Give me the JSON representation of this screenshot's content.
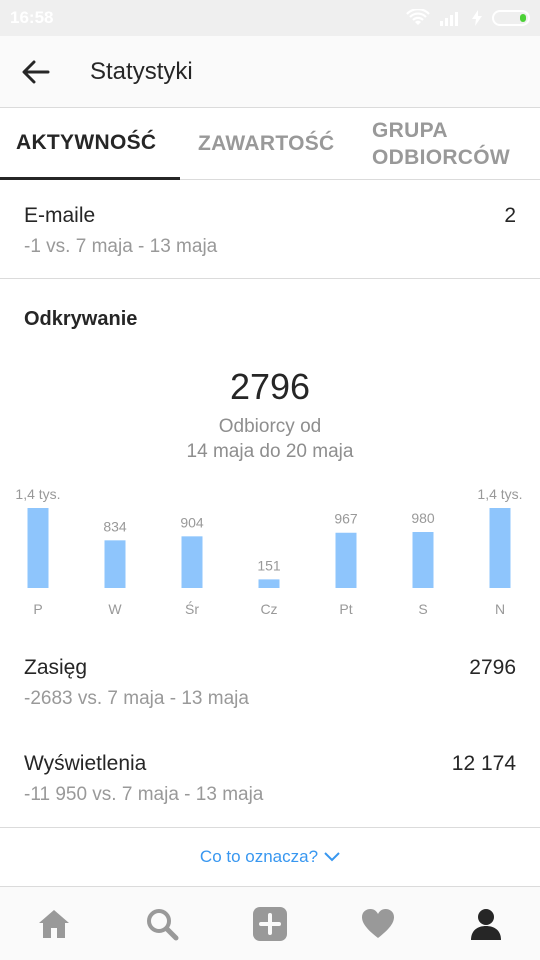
{
  "status": {
    "time": "16:58"
  },
  "header": {
    "title": "Statystyki"
  },
  "tabs": {
    "activity": "AKTYWNOŚĆ",
    "content": "ZAWARTOŚĆ",
    "audience": "GRUPA\nODBIORCÓW"
  },
  "emails": {
    "label": "E-maile",
    "value": "2",
    "sub": "-1 vs. 7 maja - 13 maja"
  },
  "discovery": {
    "title": "Odkrywanie",
    "big_number": "2796",
    "caption1": "Odbiorcy od",
    "caption2": "14 maja do 20 maja"
  },
  "chart_data": {
    "type": "bar",
    "categories": [
      "P",
      "W",
      "Śr",
      "Cz",
      "Pt",
      "S",
      "N"
    ],
    "values": [
      1400,
      834,
      904,
      151,
      967,
      980,
      1400
    ],
    "labels": [
      "1,4 tys.",
      "834",
      "904",
      "151",
      "967",
      "980",
      "1,4 tys."
    ],
    "color": "#8ec5fc"
  },
  "reach": {
    "label": "Zasięg",
    "value": "2796",
    "sub": "-2683 vs. 7 maja - 13 maja"
  },
  "impressions": {
    "label": "Wyświetlenia",
    "value": "12 174",
    "sub": "-11 950 vs. 7 maja - 13 maja"
  },
  "info_link": {
    "label": "Co to oznacza?"
  },
  "nav": {
    "icons": [
      "home-icon",
      "search-icon",
      "add-icon",
      "heart-icon",
      "profile-icon"
    ]
  }
}
